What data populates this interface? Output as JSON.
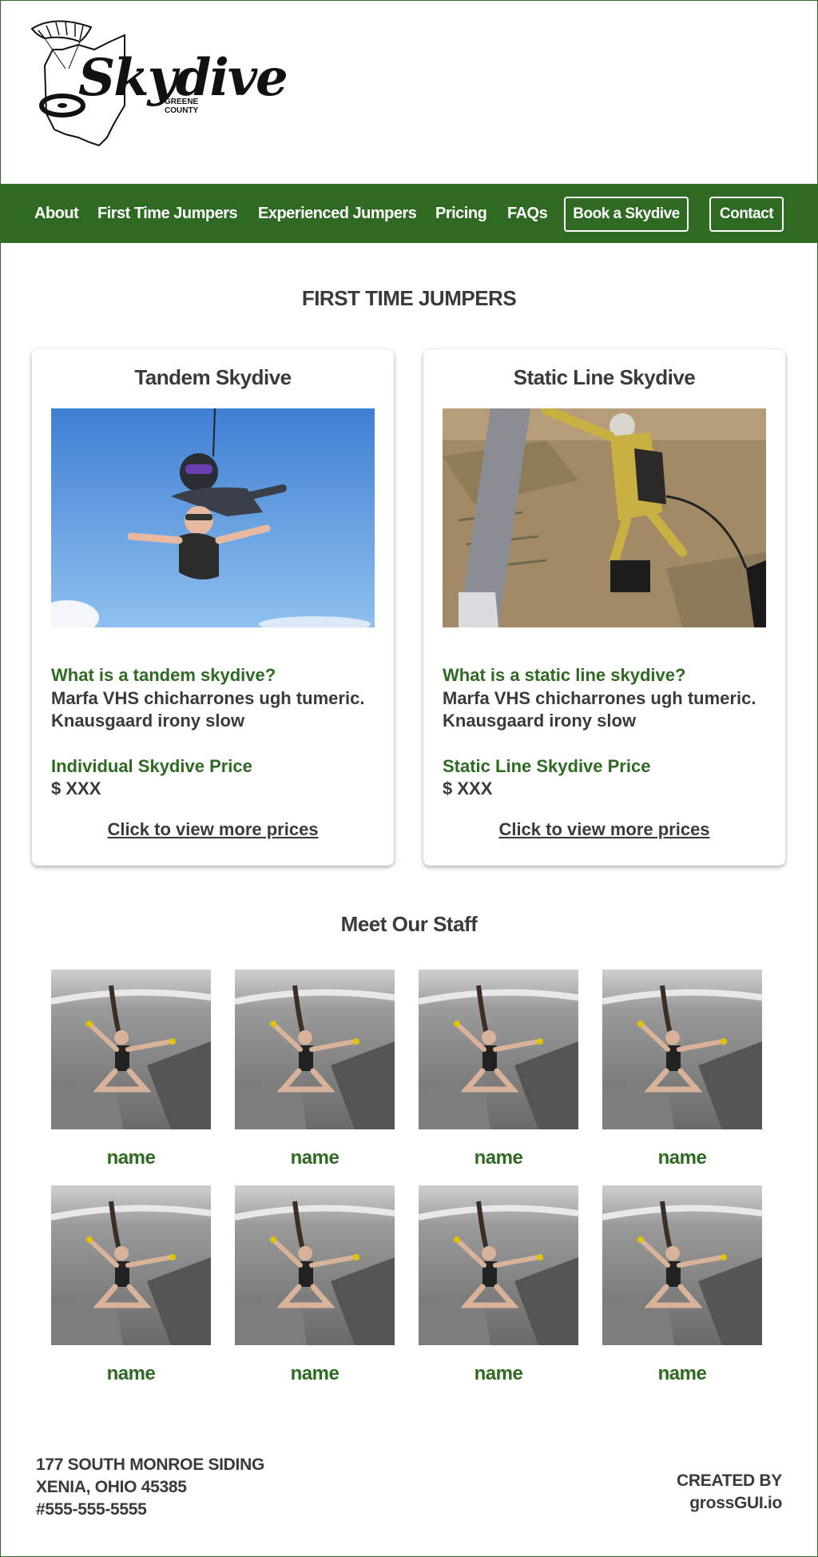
{
  "brand": {
    "name": "Skydive",
    "sub_line_1": "GREENE",
    "sub_line_2": "COUNTY"
  },
  "nav": {
    "items": [
      {
        "label": "About"
      },
      {
        "label": "First Time Jumpers"
      },
      {
        "label": "Experienced Jumpers"
      },
      {
        "label": "Pricing"
      },
      {
        "label": "FAQs"
      }
    ],
    "book_label": "Book a Skydive",
    "contact_label": "Contact"
  },
  "first_time": {
    "heading": "FIRST TIME JUMPERS",
    "cards": [
      {
        "title": "Tandem Skydive",
        "question": "What is a tandem skydive?",
        "description": "Marfa VHS chicharrones ugh tumeric. Knausgaard irony slow",
        "price_label": "Individual Skydive Price",
        "price": "$ XXX",
        "link": "Click to view more prices"
      },
      {
        "title": "Static Line Skydive",
        "question": "What is a static line skydive?",
        "description": "Marfa VHS chicharrones ugh tumeric. Knausgaard irony slow",
        "price_label": "Static Line Skydive Price",
        "price": "$ XXX",
        "link": "Click to view more prices"
      }
    ]
  },
  "staff": {
    "heading": "Meet Our Staff",
    "members": [
      {
        "name": "name"
      },
      {
        "name": "name"
      },
      {
        "name": "name"
      },
      {
        "name": "name"
      },
      {
        "name": "name"
      },
      {
        "name": "name"
      },
      {
        "name": "name"
      },
      {
        "name": "name"
      }
    ]
  },
  "footer": {
    "address_line_1": "177 SOUTH MONROE SIDING",
    "address_line_2": "XENIA, OHIO 45385",
    "phone": "#555-555-5555",
    "created_by": "CREATED BY",
    "creator": "grossGUI.io"
  },
  "colors": {
    "brand_green": "#2e6a22",
    "text_dark": "#3a3a3a",
    "white": "#ffffff"
  }
}
